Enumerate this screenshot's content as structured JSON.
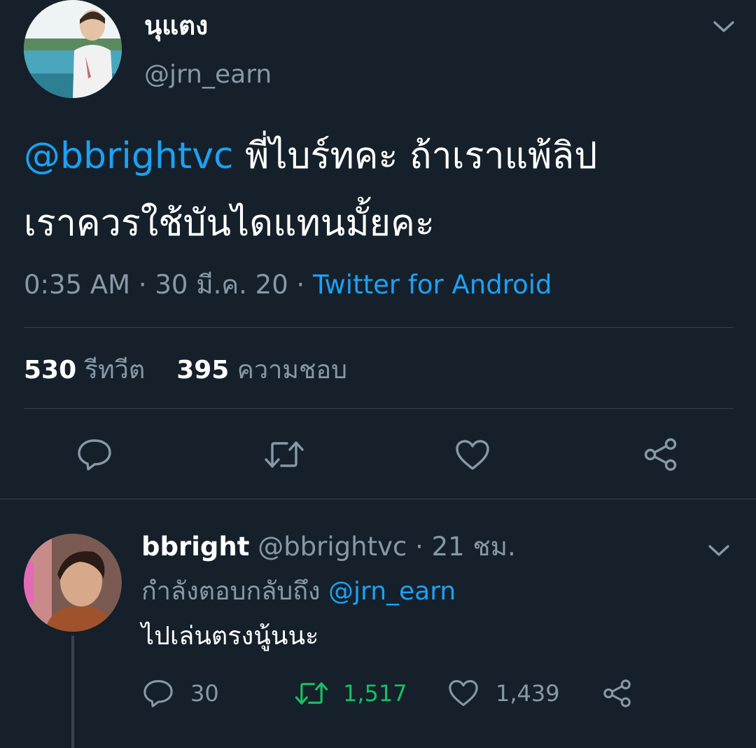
{
  "main_tweet": {
    "author_name": "นุแตง",
    "author_handle": "@jrn_earn",
    "mention": "@bbrightvc",
    "text_line1": " พี่ไบร์ทคะ ถ้าเราแพ้ลิป",
    "text_line2": "เราควรใช้บันไดแทนมั้ยคะ",
    "time": "0:35 AM",
    "date": "30 มี.ค. 20",
    "separator": "·",
    "source": "Twitter for Android",
    "retweet_count": "530",
    "retweet_label": "รีทวีต",
    "like_count": "395",
    "like_label": "ความชอบ"
  },
  "reply_tweet": {
    "author_name": "bbright",
    "author_handle": "@bbrightvc",
    "separator": "·",
    "time_ago": "21 ชม.",
    "replying_to_label": "กำลังตอบกลับถึง",
    "replying_to_handle": "@jrn_earn",
    "text": "ไปเล่นตรงนู้นนะ",
    "reply_count": "30",
    "retweet_count": "1,517",
    "like_count": "1,439"
  },
  "colors": {
    "background": "#15202b",
    "accent": "#1da1f2",
    "muted": "#8899a6",
    "retweeted": "#17bf63",
    "divider": "#38444d"
  },
  "icons": {
    "caret": "chevron-down-icon",
    "reply": "reply-icon",
    "retweet": "retweet-icon",
    "like": "heart-icon",
    "share": "share-icon"
  }
}
